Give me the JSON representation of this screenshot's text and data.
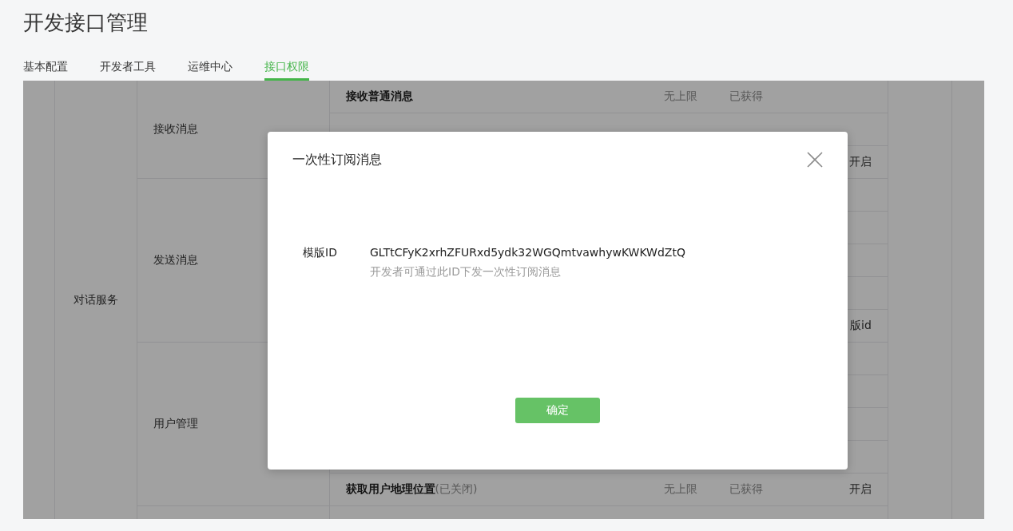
{
  "page_title": "开发接口管理",
  "tabs": [
    {
      "label": "基本配置",
      "selected": false
    },
    {
      "label": "开发者工具",
      "selected": false
    },
    {
      "label": "运维中心",
      "selected": false
    },
    {
      "label": "接口权限",
      "selected": true
    }
  ],
  "table": {
    "category": "对话服务",
    "groups": [
      {
        "name": "接收消息",
        "rows": [
          {
            "name": "接收普通消息",
            "limit": "无上限",
            "status": "已获得"
          },
          {},
          {
            "action": "开启"
          }
        ]
      },
      {
        "name": "发送消息",
        "rows": [
          {},
          {},
          {},
          {},
          {
            "action": "版id"
          }
        ]
      },
      {
        "name": "用户管理",
        "rows": [
          {},
          {},
          {},
          {},
          {
            "name": "获取用户地理位置",
            "note": "(已关闭)",
            "limit": "无上限",
            "status": "已获得",
            "action": "开启"
          }
        ]
      },
      {
        "rows": [
          {}
        ]
      }
    ]
  },
  "dialog": {
    "title": "一次性订阅消息",
    "field_label": "模版ID",
    "field_value": "GLTtCFyK2xrhZFURxd5ydk32WGQmtvawhywKWKWdZtQ",
    "hint": "开发者可通过此ID下发一次性订阅消息",
    "button": "确定"
  }
}
